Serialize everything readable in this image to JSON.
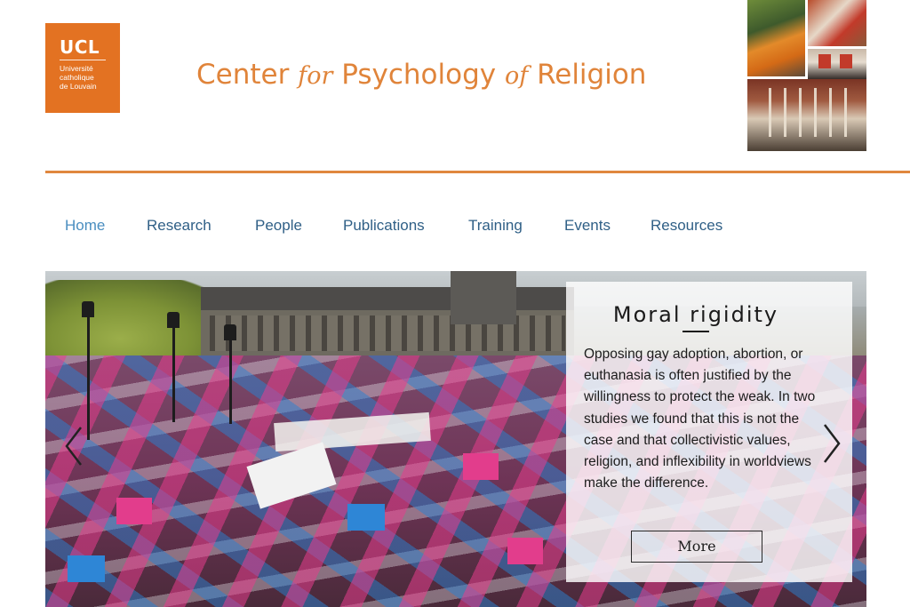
{
  "logo": {
    "main": "UCL",
    "sub_lines": [
      "Université",
      "catholique",
      "de Louvain"
    ],
    "color": "#e37222"
  },
  "site_title": {
    "part1": "Center",
    "part2": "for",
    "part3": "Psychology",
    "part4": "of",
    "part5": "Religion",
    "color": "#e0843a"
  },
  "nav": {
    "items": [
      {
        "label": "Home",
        "active": true
      },
      {
        "label": "Research",
        "active": false
      },
      {
        "label": "People",
        "active": false
      },
      {
        "label": "Publications",
        "active": false
      },
      {
        "label": "Training",
        "active": false
      },
      {
        "label": "Events",
        "active": false
      },
      {
        "label": "Resources",
        "active": false
      }
    ],
    "color": "#2f5f86",
    "active_color": "#4a8ec0"
  },
  "slide": {
    "title": "Moral rigidity",
    "body": "Opposing gay adoption, abortion, or euthanasia is often justified by the willingness to protect the weak. In two studies we found that this is not the case and that collectivistic values, religion, and inflexibility in worldviews make the difference.",
    "more_label": "More"
  },
  "icons": {
    "prev": "chevron-left-icon",
    "next": "chevron-right-icon"
  },
  "accent": "#e0873e"
}
